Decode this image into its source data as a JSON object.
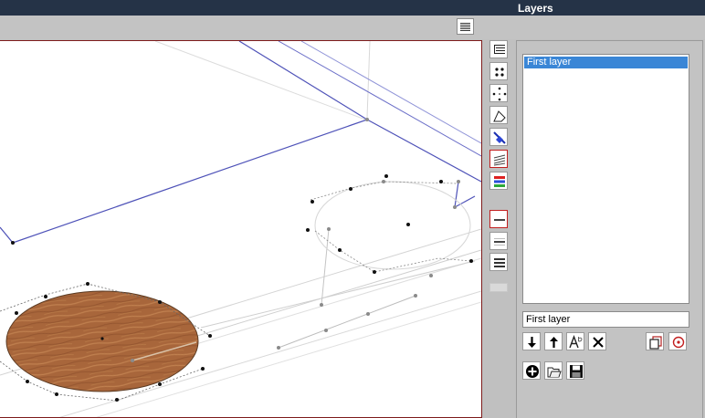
{
  "window": {
    "title": "Layers"
  },
  "layers_panel": {
    "layers": [
      {
        "name": "First layer",
        "selected": true
      }
    ],
    "name_input_value": "First layer"
  },
  "colors": {
    "title_bar": "#253347",
    "selection": "#3a86d6",
    "active_tool_border": "#c21f1f",
    "viewport_border": "#7e1c1c"
  },
  "icons": {
    "panel_menu": "lines-menu-icon",
    "move_down": "arrow-down-icon",
    "move_up": "arrow-up-icon",
    "rename": "rename-ab-icon",
    "delete": "delete-x-icon",
    "duplicate": "duplicate-icon",
    "set_active": "target-circle-icon",
    "add": "plus-circle-icon",
    "open": "open-folder-icon",
    "save": "floppy-save-icon"
  }
}
